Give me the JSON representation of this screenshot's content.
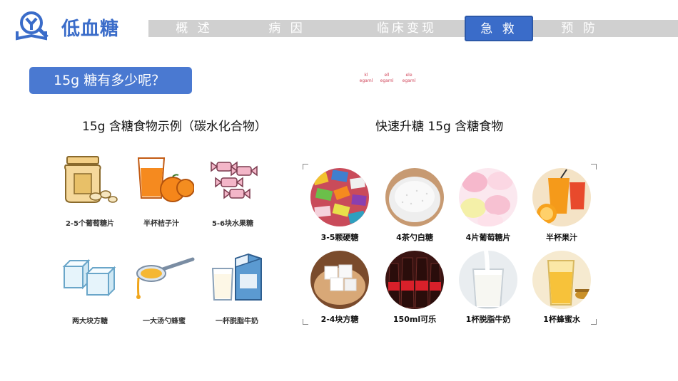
{
  "header": {
    "brand": "低血糖",
    "nav": [
      "概 述",
      "病 因",
      "临床变现",
      "急 救",
      "预 防"
    ],
    "active_index": 3,
    "colors": {
      "accent": "#3a6cc9",
      "nav_bg": "#d0d0d0"
    }
  },
  "section": {
    "title": "15g 糖有多少呢？",
    "tiny_labels": [
      {
        "line1": "kl",
        "line2": "egaml"
      },
      {
        "line1": "ell",
        "line2": "egaml"
      },
      {
        "line1": "ele",
        "line2": "egaml"
      }
    ]
  },
  "left_panel": {
    "caption": "15g 含糖食物示例（碳水化合物）",
    "items": [
      {
        "label": "2-5个葡萄糖片",
        "icon": "glucose-jar-icon"
      },
      {
        "label": "半杯桔子汁",
        "icon": "orange-juice-icon"
      },
      {
        "label": "5-6块水果糖",
        "icon": "candy-icon"
      },
      {
        "label": "两大块方糖",
        "icon": "sugar-cube-icon"
      },
      {
        "label": "一大汤勺蜂蜜",
        "icon": "honey-spoon-icon"
      },
      {
        "label": "一杯脱脂牛奶",
        "icon": "milk-carton-icon"
      }
    ]
  },
  "right_panel": {
    "caption": "快速升糖 15g 含糖食物",
    "items": [
      {
        "label": "3-5颗硬糖",
        "icon": "hard-candy-photo"
      },
      {
        "label": "4茶勺白糖",
        "icon": "white-sugar-photo"
      },
      {
        "label": "4片葡萄糖片",
        "icon": "glucose-tablet-photo"
      },
      {
        "label": "半杯果汁",
        "icon": "juice-photo"
      },
      {
        "label": "2-4块方糖",
        "icon": "sugar-cube-photo"
      },
      {
        "label": "150ml可乐",
        "icon": "cola-photo"
      },
      {
        "label": "1杯脱脂牛奶",
        "icon": "milk-photo"
      },
      {
        "label": "1杯蜂蜜水",
        "icon": "honey-water-photo"
      }
    ]
  }
}
